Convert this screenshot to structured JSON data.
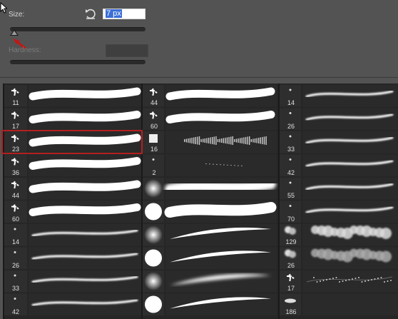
{
  "size": {
    "label": "Size:",
    "value": "7 px"
  },
  "hardness": {
    "label": "Hardness:"
  },
  "brushes": {
    "col1": [
      {
        "num": "11",
        "kind": "splat",
        "stroke": "rough"
      },
      {
        "num": "17",
        "kind": "splat",
        "stroke": "rough"
      },
      {
        "num": "23",
        "kind": "splat",
        "stroke": "rough"
      },
      {
        "num": "36",
        "kind": "splat",
        "stroke": "rough"
      },
      {
        "num": "44",
        "kind": "splat",
        "stroke": "rough"
      },
      {
        "num": "60",
        "kind": "splat",
        "stroke": "rough"
      },
      {
        "num": "14",
        "kind": "dot",
        "stroke": "thin"
      },
      {
        "num": "26",
        "kind": "dot",
        "stroke": "thin"
      },
      {
        "num": "33",
        "kind": "dot",
        "stroke": "thin"
      },
      {
        "num": "42",
        "kind": "dot",
        "stroke": "thin"
      }
    ],
    "col2": [
      {
        "num": "44",
        "kind": "splat",
        "stroke": "rough"
      },
      {
        "num": "60",
        "kind": "splat",
        "stroke": "rough"
      },
      {
        "num": "16",
        "kind": "square",
        "stroke": "grass"
      },
      {
        "num": "2",
        "kind": "dot",
        "stroke": "dotted"
      },
      {
        "num": "",
        "kind": "soft",
        "stroke": "softwide"
      },
      {
        "num": "",
        "kind": "hard",
        "stroke": "hardwide"
      },
      {
        "num": "",
        "kind": "soft",
        "stroke": "taper"
      },
      {
        "num": "",
        "kind": "hard",
        "stroke": "taper"
      },
      {
        "num": "",
        "kind": "soft",
        "stroke": "softtaper"
      },
      {
        "num": "",
        "kind": "hard",
        "stroke": "taper"
      }
    ],
    "col3": [
      {
        "num": "14",
        "kind": "dot",
        "stroke": "thin"
      },
      {
        "num": "26",
        "kind": "dot",
        "stroke": "thin"
      },
      {
        "num": "33",
        "kind": "dot",
        "stroke": "thin"
      },
      {
        "num": "42",
        "kind": "dot",
        "stroke": "thin"
      },
      {
        "num": "55",
        "kind": "dot",
        "stroke": "thin"
      },
      {
        "num": "70",
        "kind": "dot",
        "stroke": "thin"
      },
      {
        "num": "129",
        "kind": "cloud",
        "stroke": "cloud"
      },
      {
        "num": "26",
        "kind": "cloud",
        "stroke": "cloudsoft"
      },
      {
        "num": "17",
        "kind": "splat",
        "stroke": "speckle"
      },
      {
        "num": "186",
        "kind": "leaf",
        "stroke": "none"
      }
    ]
  },
  "selected_brush": "23"
}
